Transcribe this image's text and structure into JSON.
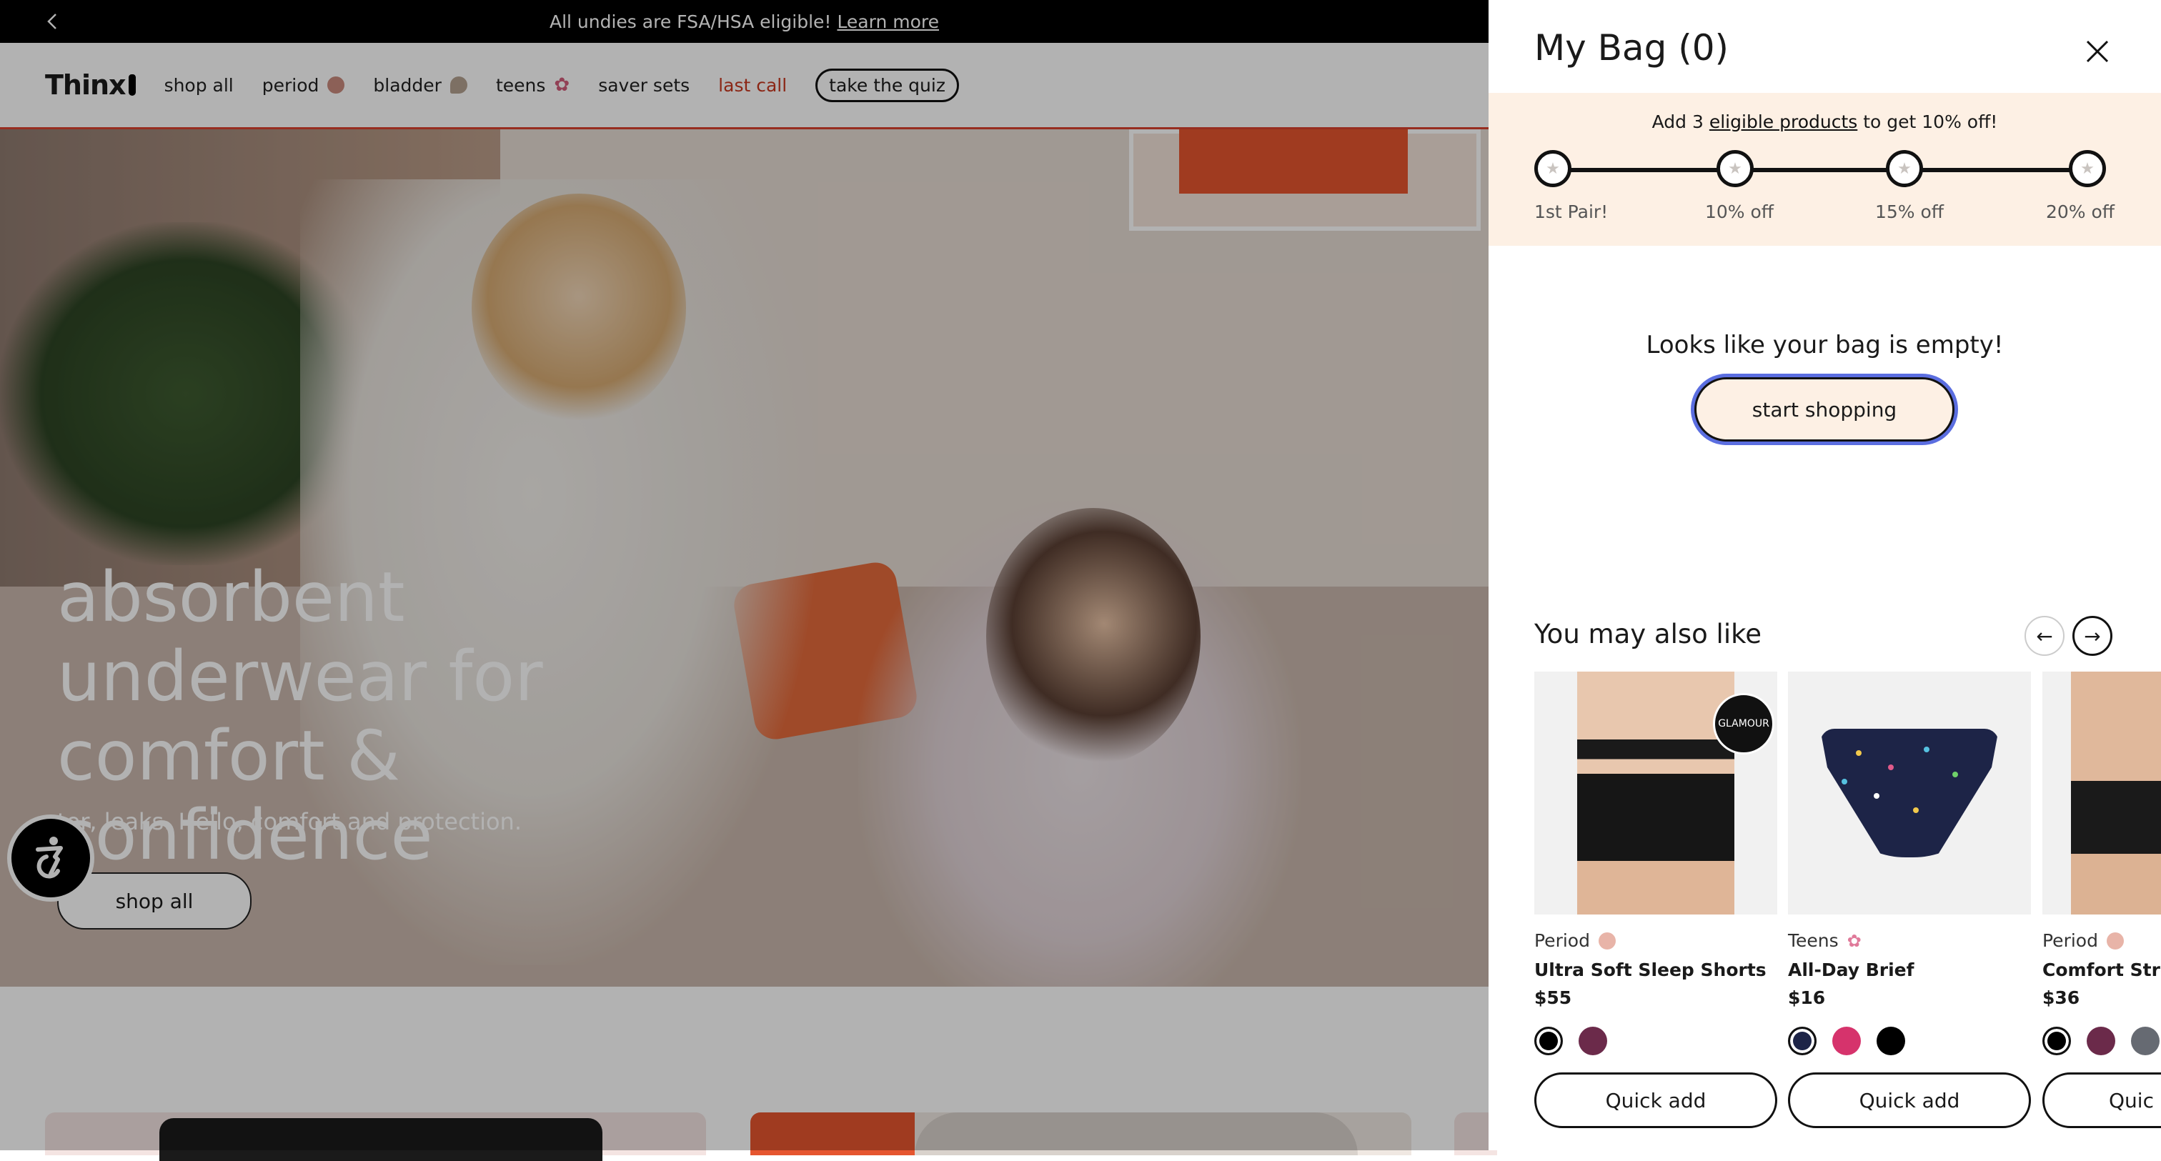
{
  "announcement": {
    "text": "All undies are FSA/HSA eligible!",
    "link": "Learn more"
  },
  "nav": {
    "logo": "Thinx",
    "items": [
      {
        "label": "shop all"
      },
      {
        "label": "period",
        "dot_color": "#c98a7d"
      },
      {
        "label": "bladder",
        "dot_color": "#b4a190"
      },
      {
        "label": "teens",
        "dot_color": "#d15c7a"
      },
      {
        "label": "saver sets"
      },
      {
        "label": "last call"
      }
    ],
    "quiz": "take the quiz"
  },
  "hero": {
    "title": "absorbent underwear for comfort & confidence",
    "subtitle": "ter, leaks. Hello, comfort and protection.",
    "button": "shop all"
  },
  "bag": {
    "title": "My Bag (0)",
    "promo_prefix": "Add 3",
    "promo_link": "eligible products",
    "promo_suffix": "to get 10% off!",
    "steps": [
      "1st Pair!",
      "10% off",
      "15% off",
      "20% off"
    ],
    "star_glyph": "★",
    "empty_message": "Looks like your bag is empty!",
    "start_button": "start shopping"
  },
  "recommendations": {
    "title": "You may also like",
    "products": [
      {
        "category": "Period",
        "category_color": "#e8b4a8",
        "name": "Ultra Soft Sleep Shorts",
        "price": "$55",
        "badge": "GLAMOUR",
        "swatches": [
          "#000000",
          "#6b2a4a"
        ],
        "button": "Quick add"
      },
      {
        "category": "Teens",
        "category_color": "#e07a9a",
        "name": "All-Day Brief",
        "price": "$16",
        "swatches": [
          "#1d2447",
          "#d6336c",
          "#000000"
        ],
        "button": "Quick add"
      },
      {
        "category": "Period",
        "category_color": "#e8b4a8",
        "name": "Comfort Stret",
        "price": "$36",
        "swatches": [
          "#000000",
          "#6b2a4a",
          "#666a72"
        ],
        "button": "Quic"
      }
    ]
  }
}
